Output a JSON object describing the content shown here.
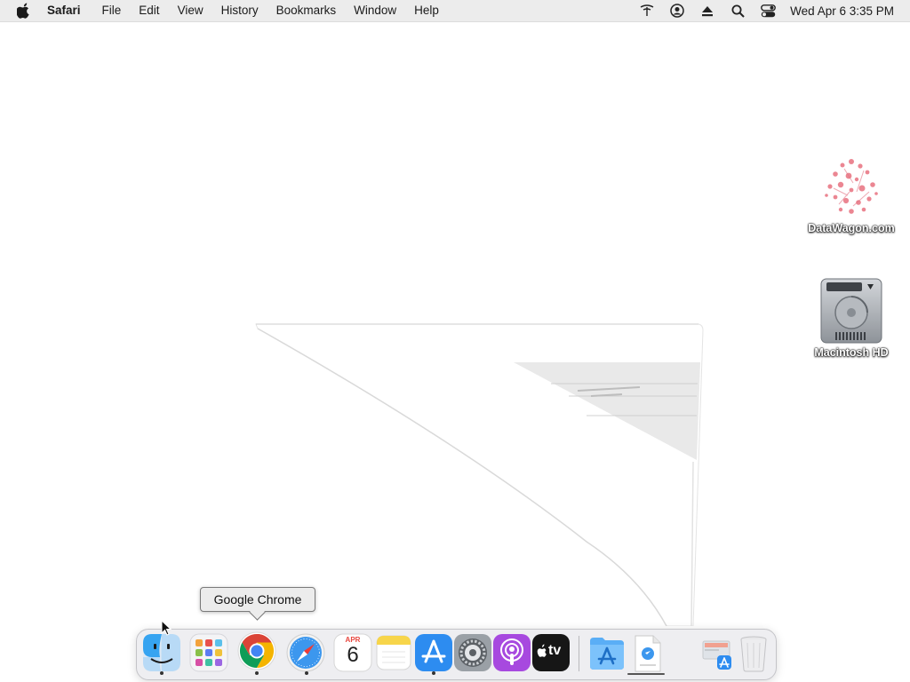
{
  "menubar": {
    "apple_icon": "apple-logo-icon",
    "app_name": "Safari",
    "menus": [
      "File",
      "Edit",
      "View",
      "History",
      "Bookmarks",
      "Window",
      "Help"
    ],
    "status_icons": [
      "network-icon",
      "user-account-icon",
      "eject-icon",
      "spotlight-search-icon",
      "control-center-icon"
    ],
    "clock": "Wed Apr 6  3:35 PM"
  },
  "desktop": {
    "icons": [
      {
        "label": "DataWagon.com",
        "icon": "datawagon-image-icon"
      },
      {
        "label": "Macintosh HD",
        "icon": "hard-drive-icon"
      }
    ]
  },
  "tooltip": {
    "text": "Google Chrome"
  },
  "dock": {
    "items": [
      {
        "name": "Finder",
        "icon": "finder-icon",
        "running": true
      },
      {
        "name": "Launchpad",
        "icon": "launchpad-icon",
        "running": false
      },
      {
        "name": "Google Chrome",
        "icon": "chrome-icon",
        "running": true
      },
      {
        "name": "Safari",
        "icon": "safari-icon",
        "running": true
      },
      {
        "name": "Calendar",
        "icon": "calendar-icon",
        "running": false,
        "month": "APR",
        "day": "6"
      },
      {
        "name": "Notes",
        "icon": "notes-icon",
        "running": false
      },
      {
        "name": "App Store",
        "icon": "app-store-icon",
        "running": true
      },
      {
        "name": "System Preferences",
        "icon": "system-preferences-icon",
        "running": false
      },
      {
        "name": "Podcasts",
        "icon": "podcasts-icon",
        "running": false
      },
      {
        "name": "TV",
        "icon": "apple-tv-icon",
        "running": false,
        "text": "tv"
      },
      {
        "name": "Applications",
        "icon": "applications-folder-icon",
        "running": false
      },
      {
        "name": "Downloads",
        "icon": "downloads-stack-icon",
        "running": false
      },
      {
        "name": "Recent Items",
        "icon": "recent-items-stack-icon",
        "running": false
      },
      {
        "name": "Trash",
        "icon": "trash-icon",
        "running": false
      }
    ]
  }
}
